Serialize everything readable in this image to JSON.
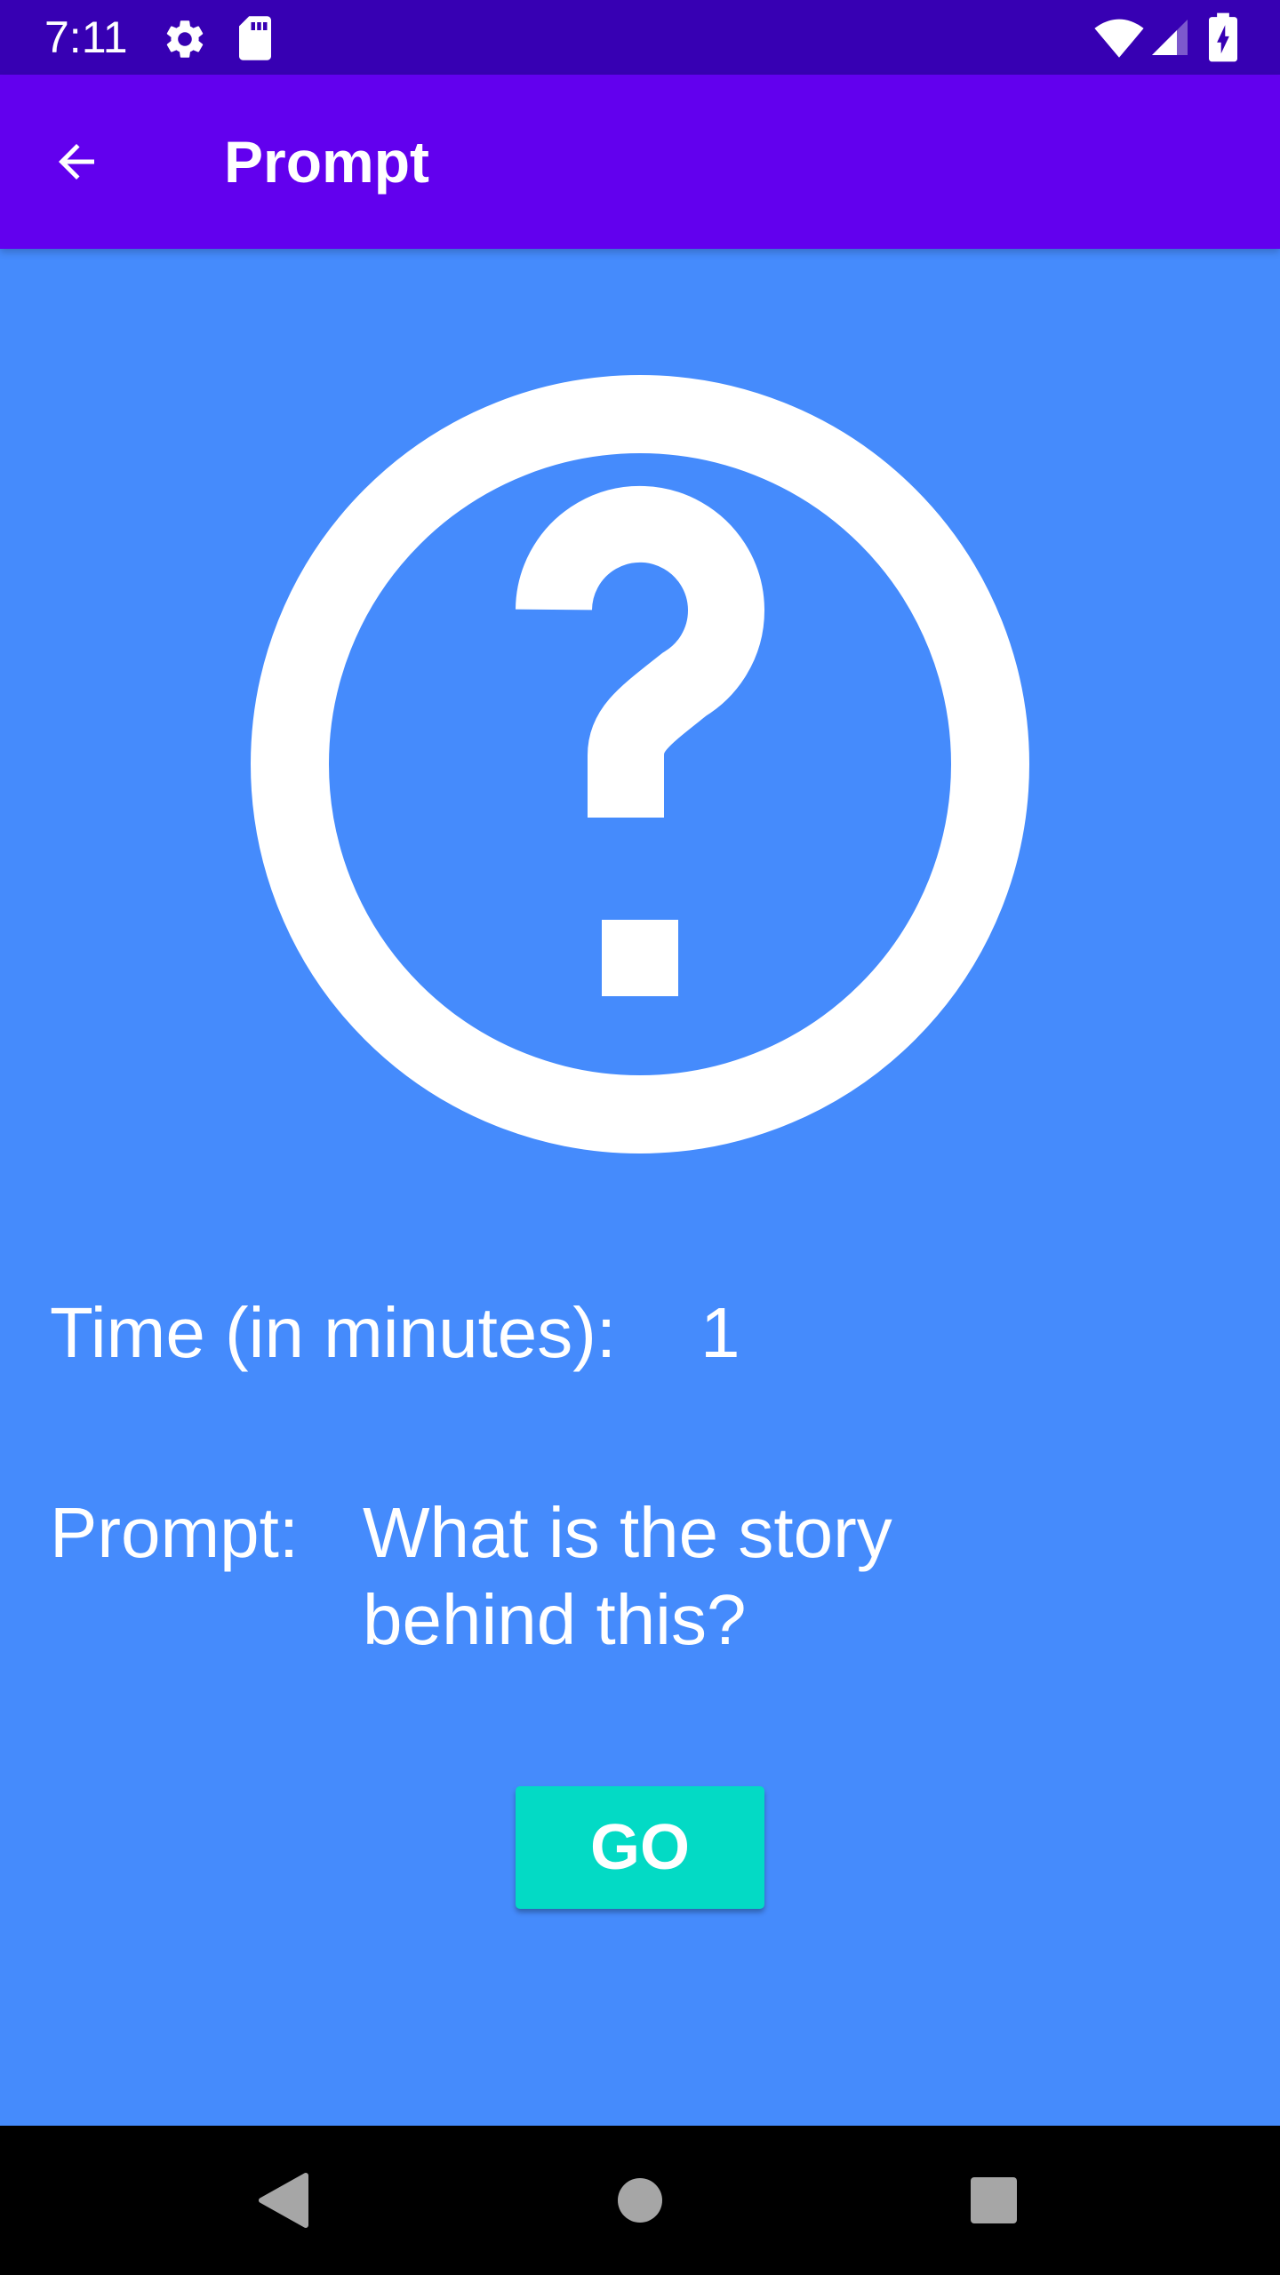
{
  "status_bar": {
    "time": "7:11",
    "icons": [
      "settings-icon",
      "sd-card-icon",
      "wifi-icon",
      "cellular-signal-icon",
      "battery-charging-icon"
    ]
  },
  "app_bar": {
    "title": "Prompt",
    "back_icon": "arrow-back-icon"
  },
  "content": {
    "main_icon": "help-circle-icon",
    "time_label": "Time (in minutes):",
    "time_value": "1",
    "prompt_label": "Prompt:",
    "prompt_text": "What is the story\nbehind this?",
    "go_label": "GO"
  },
  "nav_bar": {
    "icons": [
      "nav-back-icon",
      "nav-home-icon",
      "nav-recents-icon"
    ]
  },
  "colors": {
    "status_bar": "#3700b3",
    "app_bar": "#6200ee",
    "background": "#458bfc",
    "button": "#03dac5",
    "text": "#ffffff",
    "nav_bar": "#000000"
  }
}
